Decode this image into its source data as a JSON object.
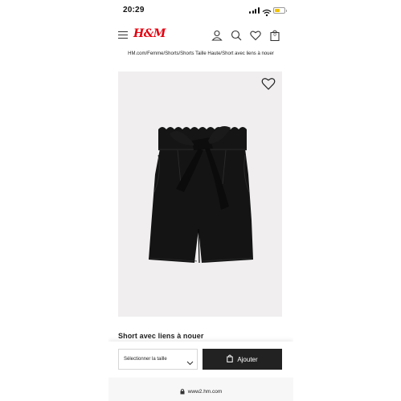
{
  "status_bar": {
    "time": "20:29",
    "battery_level": 0.5,
    "battery_color": "#f2c200"
  },
  "header": {
    "menu_icon": "hamburger-menu-icon",
    "logo": "H&M",
    "logo_color": "#e50010",
    "icons": [
      "account-icon",
      "search-icon",
      "heart-icon",
      "shopping-bag-icon"
    ],
    "bag_count": "0"
  },
  "breadcrumb": "HM.com/Femme/Shorts/Shorts Taille Haute/Short avec liens à nouer",
  "product": {
    "favorite_icon": "heart-outline-icon",
    "title": "Short avec liens à nouer",
    "image_bg": "#f0eeee",
    "garment_color": "#151515"
  },
  "actions": {
    "size_select_label": "Sélectionner la taille",
    "add_button_label": "Ajouter",
    "add_button_bg": "#222222"
  },
  "browser": {
    "lock_icon": "lock-icon",
    "url": "www2.hm.com"
  }
}
